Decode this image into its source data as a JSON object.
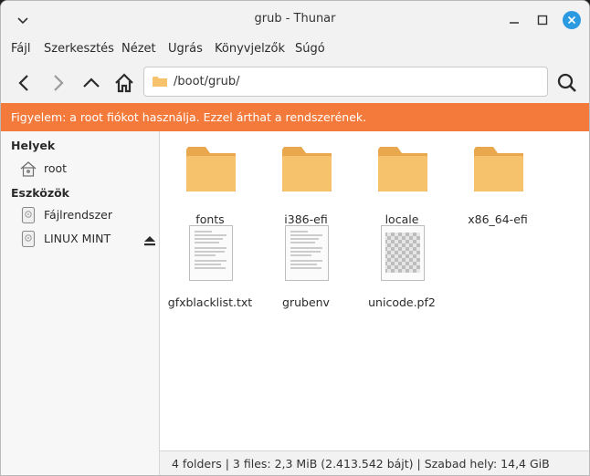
{
  "window": {
    "title": "grub - Thunar"
  },
  "menubar": {
    "items": [
      "Fájl",
      "Szerkesztés",
      "Nézet",
      "Ugrás",
      "Könyvjelzők",
      "Súgó"
    ]
  },
  "location": {
    "path": "/boot/grub/"
  },
  "banner": {
    "text": "Figyelem: a root fiókot használja. Ezzel árthat a rendszerének.",
    "color": "#f37a3a"
  },
  "sidebar": {
    "places_heading": "Helyek",
    "places": [
      {
        "label": "root",
        "icon": "home-icon"
      }
    ],
    "devices_heading": "Eszközök",
    "devices": [
      {
        "label": "Fájlrendszer",
        "icon": "drive-icon"
      },
      {
        "label": "LINUX MINT",
        "icon": "drive-icon",
        "eject": "eject-icon"
      }
    ]
  },
  "files": [
    {
      "name": "fonts",
      "type": "folder"
    },
    {
      "name": "i386-efi",
      "type": "folder"
    },
    {
      "name": "locale",
      "type": "folder"
    },
    {
      "name": "x86_64-efi",
      "type": "folder"
    },
    {
      "name": "gfxblacklist.txt",
      "type": "text"
    },
    {
      "name": "grubenv",
      "type": "text"
    },
    {
      "name": "unicode.pf2",
      "type": "font"
    }
  ],
  "status": {
    "folders": "4 folders",
    "files": "3 files: 2,3 MiB (2.413.542 bájt)",
    "free": "Szabad hely: 14,4 GiB",
    "separator": "|"
  },
  "colors": {
    "folder": "#f6c26b",
    "folder_dark": "#e9a84e",
    "accent": "#f37a3a"
  }
}
